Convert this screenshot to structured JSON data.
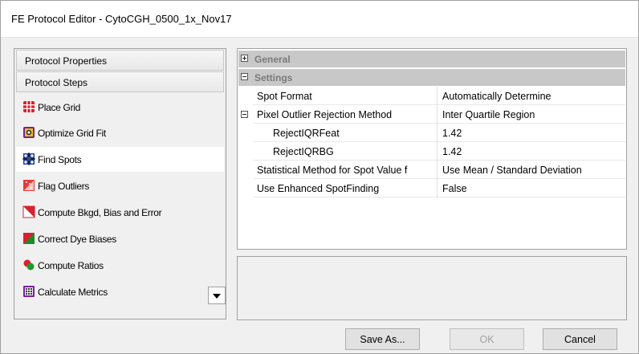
{
  "window": {
    "title": "FE Protocol Editor - CytoCGH_0500_1x_Nov17"
  },
  "sidebar": {
    "headers": [
      "Protocol Properties",
      "Protocol Steps"
    ],
    "steps": [
      {
        "label": "Place Grid",
        "icon": "grid-icon"
      },
      {
        "label": "Optimize Grid Fit",
        "icon": "optimize-icon"
      },
      {
        "label": "Find Spots",
        "icon": "find-spots-icon",
        "selected": true
      },
      {
        "label": "Flag Outliers",
        "icon": "flag-outliers-icon"
      },
      {
        "label": "Compute Bkgd, Bias and Error",
        "icon": "compute-bkgd-icon"
      },
      {
        "label": "Correct Dye Biases",
        "icon": "dye-bias-icon"
      },
      {
        "label": "Compute Ratios",
        "icon": "ratios-icon"
      },
      {
        "label": "Calculate Metrics",
        "icon": "metrics-icon"
      }
    ]
  },
  "grid": {
    "categories": {
      "general": "General",
      "settings": "Settings"
    },
    "rows": [
      {
        "name": "Spot Format",
        "value": "Automatically Determine"
      },
      {
        "name": "Pixel Outlier Rejection Method",
        "value": "Inter Quartile Region"
      },
      {
        "name": "RejectIQRFeat",
        "value": "1.42"
      },
      {
        "name": "RejectIQRBG",
        "value": "1.42"
      },
      {
        "name": "Statistical Method for Spot Value f",
        "value": "Use Mean / Standard Deviation"
      },
      {
        "name": "Use Enhanced SpotFinding",
        "value": "False"
      }
    ]
  },
  "buttons": {
    "save_as": "Save As...",
    "ok": "OK",
    "cancel": "Cancel"
  }
}
